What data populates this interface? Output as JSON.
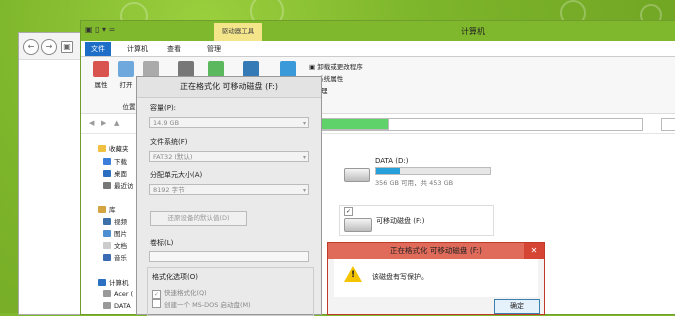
{
  "window": {
    "title": "计算机",
    "tools_tab": "驱动器工具",
    "tabs": [
      "文件",
      "计算机",
      "查看",
      "管理"
    ]
  },
  "ribbon": {
    "properties": "属性",
    "open": "打开",
    "location_group": "位置",
    "uninstall": "卸载或更改程序",
    "system_properties": "系统属性",
    "manage": "理"
  },
  "nav": {
    "favorites": "收藏夹",
    "downloads": "下载",
    "desktop": "桌面",
    "recent": "最近访",
    "libraries": "库",
    "videos": "视频",
    "pictures": "图片",
    "documents": "文档",
    "music": "音乐",
    "computer": "计算机",
    "acer": "Acer (",
    "data": "DATA"
  },
  "format_dialog": {
    "title": "正在格式化 可移动磁盘 (F:)",
    "capacity_label": "容量(P):",
    "capacity_value": "14.9 GB",
    "filesystem_label": "文件系统(F)",
    "filesystem_value": "FAT32 (默认)",
    "alloc_label": "分配单元大小(A)",
    "alloc_value": "8192 字节",
    "restore_button": "还原设备的默认值(D)",
    "volume_label": "卷标(L)",
    "options_label": "格式化选项(O)",
    "quick_format": "快速格式化(Q)",
    "msdos": "创建一个 MS-DOS 启动盘(M)"
  },
  "drives": {
    "data_name": "DATA (D:)",
    "data_usage": "356 GB 可用，共 453 GB",
    "data_used_fraction": 0.21,
    "removable_name": "可移动磁盘 (F:)"
  },
  "alert": {
    "title": "正在格式化 可移动磁盘 (F:)",
    "close": "✕",
    "message": "该磁盘有写保护。",
    "ok": "确定"
  }
}
